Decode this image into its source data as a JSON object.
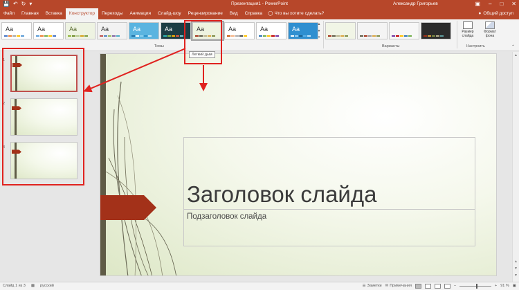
{
  "window": {
    "title": "Презентация1 - PowerPoint",
    "user": "Александр Григорьев",
    "share": "Общий доступ"
  },
  "qat": {
    "save_icon": "save-icon",
    "undo_icon": "undo-icon",
    "redo_icon": "redo-icon"
  },
  "tabs": [
    {
      "label": "Файл"
    },
    {
      "label": "Главная"
    },
    {
      "label": "Вставка"
    },
    {
      "label": "Конструктор",
      "active": true
    },
    {
      "label": "Переходы"
    },
    {
      "label": "Анимация"
    },
    {
      "label": "Слайд-шоу"
    },
    {
      "label": "Рецензирование"
    },
    {
      "label": "Вид"
    },
    {
      "label": "Справка"
    }
  ],
  "tell_me": "Что вы хотите сделать?",
  "ribbon": {
    "themes_label": "Темы",
    "variants_label": "Варианты",
    "customize_label": "Настроить",
    "slide_size": "Размер слайда",
    "format_background": "Формат фона",
    "themes": [
      {
        "aa": "Aa",
        "bg": "#ffffff",
        "text": "#333333",
        "bars": [
          "#4472c4",
          "#ed7d31",
          "#a5a5a5",
          "#ffc000",
          "#5b9bd5"
        ]
      },
      {
        "aa": "Aa",
        "bg": "#ffffff",
        "text": "#333333",
        "bars": [
          "#5b9bd5",
          "#ed7d31",
          "#70ad47",
          "#ffc000",
          "#4472c4"
        ]
      },
      {
        "aa": "Aa",
        "bg": "#eef3e2",
        "text": "#5a6b30",
        "bars": [
          "#8fb339",
          "#6e8c2a",
          "#b5c98a",
          "#d4a017",
          "#7a9a3a"
        ]
      },
      {
        "aa": "Aa",
        "bg": "#f2f2f2",
        "text": "#333333",
        "bars": [
          "#c0504d",
          "#4f81bd",
          "#9bbb59",
          "#8064a2",
          "#4bacc6"
        ]
      },
      {
        "aa": "Aa",
        "bg": "#5ab4e0",
        "text": "#ffffff",
        "bars": [
          "#1f6fa5",
          "#ffffff",
          "#8ad0f0",
          "#2a8fc7",
          "#c8e8f7"
        ]
      },
      {
        "aa": "Aa",
        "bg": "#1c3d44",
        "text": "#ffffff",
        "bars": [
          "#2db7b5",
          "#8bc34a",
          "#ffb300",
          "#e55b3c",
          "#7ecbd6"
        ]
      },
      {
        "aa": "Aa",
        "bg": "#eef3e0",
        "text": "#333333",
        "bars": [
          "#a33119",
          "#5f5b46",
          "#b9b28c",
          "#d9a441",
          "#7d8b45"
        ],
        "selected": true
      },
      {
        "aa": "Aa",
        "bg": "#ffffff",
        "text": "#333333",
        "bars": [
          "#c55a11",
          "#f4b183",
          "#a9a9a9",
          "#4d4d4d",
          "#ffc000"
        ]
      },
      {
        "aa": "Aa",
        "bg": "#ffffff",
        "text": "#333333",
        "bars": [
          "#2e75b6",
          "#70ad47",
          "#ffc000",
          "#c00000",
          "#7030a0"
        ]
      },
      {
        "aa": "Aa",
        "bg": "#2f8fd0",
        "text": "#ffffff",
        "bars": [
          "#ffffff",
          "#9fd3f5",
          "#1d5f8c",
          "#5fb2e8",
          "#c4e6fb"
        ]
      }
    ],
    "variants": [
      {
        "bg": "#f1f5e6",
        "bars": [
          "#a33119",
          "#5f5b46",
          "#b9b28c",
          "#d9a441",
          "#7d8b45"
        ]
      },
      {
        "bg": "#f4f4f4",
        "bars": [
          "#5f5b46",
          "#a33119",
          "#9a9a9a",
          "#d9a441",
          "#7d8b45"
        ]
      },
      {
        "bg": "#f7f7f7",
        "bars": [
          "#7030a0",
          "#c00000",
          "#ffc000",
          "#2e75b6",
          "#70ad47"
        ]
      },
      {
        "bg": "#2b2b2b",
        "bars": [
          "#a33119",
          "#d9a441",
          "#7d8b45",
          "#b9b28c",
          "#5f9ea0"
        ]
      }
    ]
  },
  "tooltip": "Легкий дым",
  "slides": [
    {
      "number": "1",
      "selected": true
    },
    {
      "number": "2"
    },
    {
      "number": "3"
    }
  ],
  "slide": {
    "title": "Заголовок слайда",
    "subtitle": "Подзаголовок слайда"
  },
  "status": {
    "slide_info": "Слайд 1 из 3",
    "language": "русский",
    "notes": "Заметки",
    "comments": "Примечания",
    "zoom": "91 %",
    "zoom_level": 0.55
  },
  "colors": {
    "brand": "#b7472a",
    "annotation": "#e0221f",
    "banner": "#a33119",
    "stripe": "#5f5b46"
  }
}
